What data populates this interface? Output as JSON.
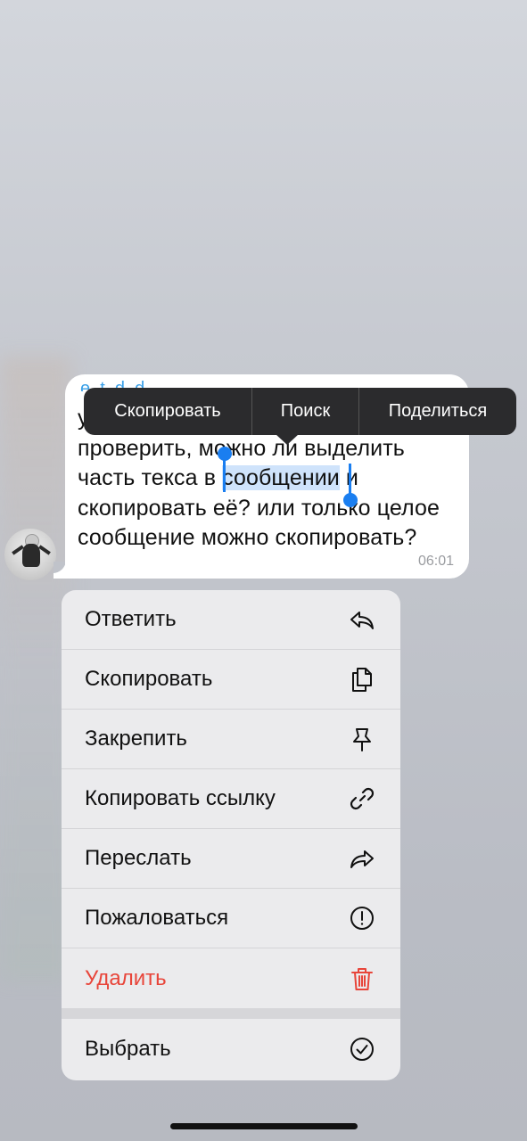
{
  "message": {
    "sender": "e_t_d_d_",
    "line1": "у",
    "line2": "проверить, можно ли выделить",
    "line3_before": "часть текса в ",
    "line3_selected": "сообщении",
    "line3_after": " и",
    "line4": "скопировать её? или только целое",
    "line5": "сообщение можно скопировать?",
    "time": "06:01"
  },
  "edit_menu": {
    "items": [
      "Скопировать",
      "Поиск",
      "Поделиться"
    ]
  },
  "context_menu": {
    "items": [
      {
        "label": "Ответить",
        "icon": "reply-icon"
      },
      {
        "label": "Скопировать",
        "icon": "copy-icon"
      },
      {
        "label": "Закрепить",
        "icon": "pin-icon"
      },
      {
        "label": "Копировать ссылку",
        "icon": "link-icon"
      },
      {
        "label": "Переслать",
        "icon": "forward-icon"
      },
      {
        "label": "Пожаловаться",
        "icon": "report-icon"
      },
      {
        "label": "Удалить",
        "icon": "trash-icon",
        "color": "#e8453a"
      }
    ],
    "extra": {
      "label": "Выбрать",
      "icon": "checkmark-circle-icon"
    }
  },
  "colors": {
    "accent": "#1a7ef0",
    "danger": "#e8453a",
    "selection": "#cfe3fb"
  }
}
